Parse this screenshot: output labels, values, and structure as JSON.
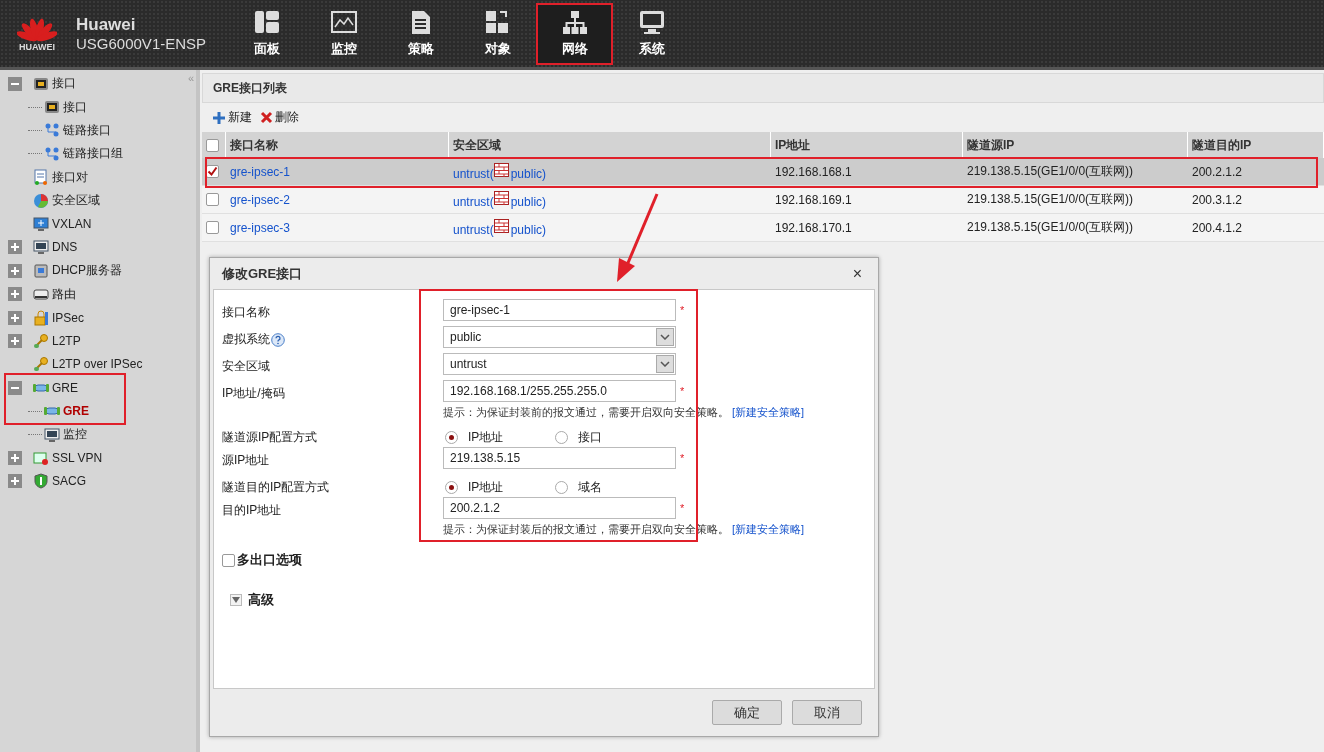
{
  "brand": {
    "logo_text": "HUAWEI",
    "name": "Huawei",
    "model": "USG6000V1-ENSP"
  },
  "nav_items": [
    {
      "label": "面板",
      "selected": false,
      "highlighted": false
    },
    {
      "label": "监控",
      "selected": false,
      "highlighted": false
    },
    {
      "label": "策略",
      "selected": false,
      "highlighted": false
    },
    {
      "label": "对象",
      "selected": false,
      "highlighted": false
    },
    {
      "label": "网络",
      "selected": true,
      "highlighted": true
    },
    {
      "label": "系统",
      "selected": false,
      "highlighted": false
    }
  ],
  "sidebar": {
    "collapse_label": "«",
    "items": [
      {
        "label": "接口",
        "expanded": true,
        "selected": false,
        "children": [
          {
            "label": "接口",
            "selected": false
          },
          {
            "label": "链路接口",
            "selected": false
          },
          {
            "label": "链路接口组",
            "selected": false
          }
        ]
      },
      {
        "label": "接口对",
        "selected": false
      },
      {
        "label": "安全区域",
        "selected": false
      },
      {
        "label": "VXLAN",
        "selected": false
      },
      {
        "label": "DNS",
        "expanded": false,
        "selected": false
      },
      {
        "label": "DHCP服务器",
        "expanded": false,
        "selected": false
      },
      {
        "label": "路由",
        "expanded": false,
        "selected": false
      },
      {
        "label": "IPSec",
        "expanded": false,
        "selected": false
      },
      {
        "label": "L2TP",
        "expanded": false,
        "selected": false
      },
      {
        "label": "L2TP over IPSec",
        "selected": false
      },
      {
        "label": "GRE",
        "expanded": true,
        "selected": false,
        "highlighted": true,
        "children": [
          {
            "label": "GRE",
            "selected": true
          },
          {
            "label": "监控",
            "selected": false
          }
        ]
      },
      {
        "label": "SSL VPN",
        "expanded": false,
        "selected": false
      },
      {
        "label": "SACG",
        "expanded": false,
        "selected": false
      }
    ]
  },
  "panel": {
    "title": "GRE接口列表",
    "toolbar": [
      {
        "kind": "add",
        "label": "新建"
      },
      {
        "kind": "delete",
        "label": "删除"
      }
    ]
  },
  "table": {
    "header_checked": false,
    "columns": [
      "接口名称",
      "安全区域",
      "IP地址",
      "隧道源IP",
      "隧道目的IP"
    ],
    "rows": [
      {
        "name": "gre-ipsec-1",
        "zone": "untrust(",
        "vsys": "public)",
        "ip": "192.168.168.1",
        "source": "219.138.5.15(GE1/0/0(互联网))",
        "destination": "200.2.1.2",
        "checked": true,
        "selected": true,
        "highlighted": true
      },
      {
        "name": "gre-ipsec-2",
        "zone": "untrust(",
        "vsys": "public)",
        "ip": "192.168.169.1",
        "source": "219.138.5.15(GE1/0/0(互联网))",
        "destination": "200.3.1.2",
        "checked": false,
        "selected": false,
        "highlighted": false
      },
      {
        "name": "gre-ipsec-3",
        "zone": "untrust(",
        "vsys": "public)",
        "ip": "192.168.170.1",
        "source": "219.138.5.15(GE1/0/0(互联网))",
        "destination": "200.4.1.2",
        "checked": false,
        "selected": false,
        "highlighted": false
      }
    ]
  },
  "annotation_arrow": true,
  "dialog": {
    "title": "修改GRE接口",
    "close": "×",
    "highlighted": true,
    "fields": [
      {
        "kind": "text",
        "label": "接口名称",
        "value": "gre-ipsec-1",
        "required_mark": "*"
      },
      {
        "kind": "select",
        "label": "虚拟系统",
        "value": "public",
        "help": true
      },
      {
        "kind": "select",
        "label": "安全区域",
        "value": "untrust"
      },
      {
        "kind": "text",
        "label": "IP地址/掩码",
        "value": "192.168.168.1/255.255.255.0",
        "required_mark": "*",
        "hint": "提示：为保证封装前的报文通过，需要开启双向安全策略。",
        "hint_link": "[新建安全策略]"
      },
      {
        "kind": "radio",
        "label": "隧道源IP配置方式",
        "options": [
          {
            "label": "IP地址",
            "selected": true
          },
          {
            "label": "接口",
            "selected": false
          }
        ]
      },
      {
        "kind": "text",
        "label": "源IP地址",
        "value": "219.138.5.15",
        "required_mark": "*"
      },
      {
        "kind": "radio",
        "label": "隧道目的IP配置方式",
        "options": [
          {
            "label": "IP地址",
            "selected": true
          },
          {
            "label": "域名",
            "selected": false
          }
        ]
      },
      {
        "kind": "text",
        "label": "目的IP地址",
        "value": "200.2.1.2",
        "required_mark": "*",
        "hint": "提示：为保证封装后的报文通过，需要开启双向安全策略。",
        "hint_link": "[新建安全策略]"
      }
    ],
    "multi_exit": {
      "label": "多出口选项",
      "checked": false
    },
    "advanced": {
      "label": "高级",
      "expanded": false
    },
    "buttons": [
      "确定",
      "取消"
    ]
  }
}
